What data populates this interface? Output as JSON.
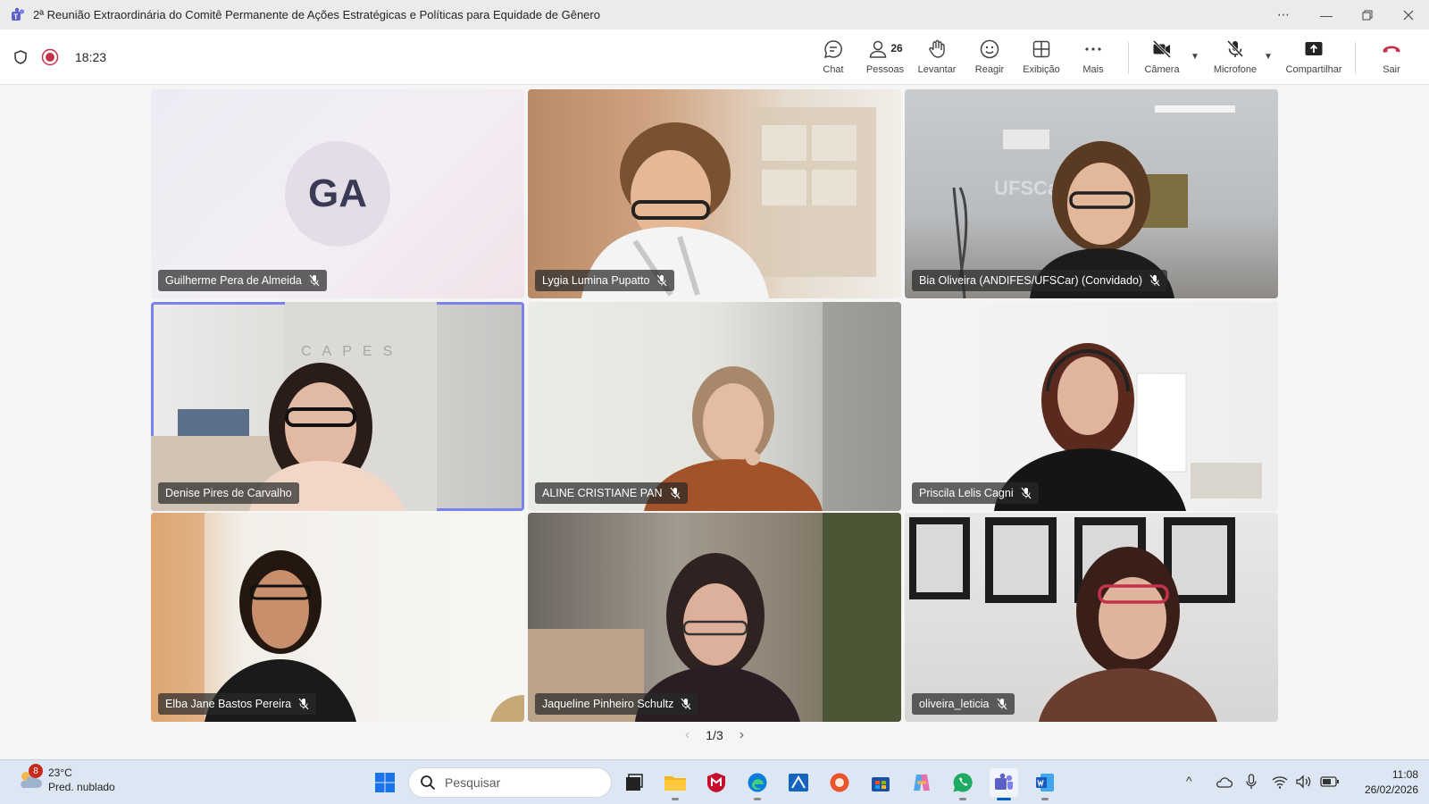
{
  "window": {
    "title": "2ª Reunião Extraordinária do Comitê Permanente de Ações Estratégicas e Políticas para Equidade de Gênero",
    "controls": [
      "more-icon",
      "minimize-icon",
      "restore-icon",
      "close-icon"
    ]
  },
  "meeting": {
    "elapsed": "18:23",
    "people_count": "26",
    "toolbar": {
      "chat": "Chat",
      "people": "Pessoas",
      "raise": "Levantar",
      "react": "Reagir",
      "view": "Exibição",
      "more": "Mais",
      "camera": "Câmera",
      "mic": "Microfone",
      "share": "Compartilhar",
      "leave": "Sair"
    },
    "accent_color": "#7b83eb",
    "leave_color": "#c4314b"
  },
  "participants": [
    {
      "name": "Guilherme Pera de Almeida",
      "initials": "GA",
      "muted": true,
      "video": false
    },
    {
      "name": "Lygia Lumina Pupatto",
      "muted": true,
      "video": true
    },
    {
      "name": "Bia Oliveira (ANDIFES/UFSCar) (Convidado)",
      "muted": true,
      "video": true
    },
    {
      "name": "Denise Pires de Carvalho",
      "muted": false,
      "video": true,
      "speaking": true
    },
    {
      "name": "ALINE CRISTIANE PAN",
      "muted": true,
      "video": true
    },
    {
      "name": "Priscila Lelis Cagni",
      "muted": true,
      "video": true
    },
    {
      "name": "Elba Jane Bastos Pereira",
      "muted": true,
      "video": true
    },
    {
      "name": "Jaqueline Pinheiro Schultz",
      "muted": true,
      "video": true
    },
    {
      "name": "oliveira_leticia",
      "muted": true,
      "video": true
    }
  ],
  "pagination": {
    "label": "1/3"
  },
  "taskbar": {
    "weather_badge": "8",
    "temperature": "23°C",
    "condition": "Pred. nublado",
    "search_placeholder": "Pesquisar",
    "time": "11:08",
    "date": "26/02/2026"
  }
}
